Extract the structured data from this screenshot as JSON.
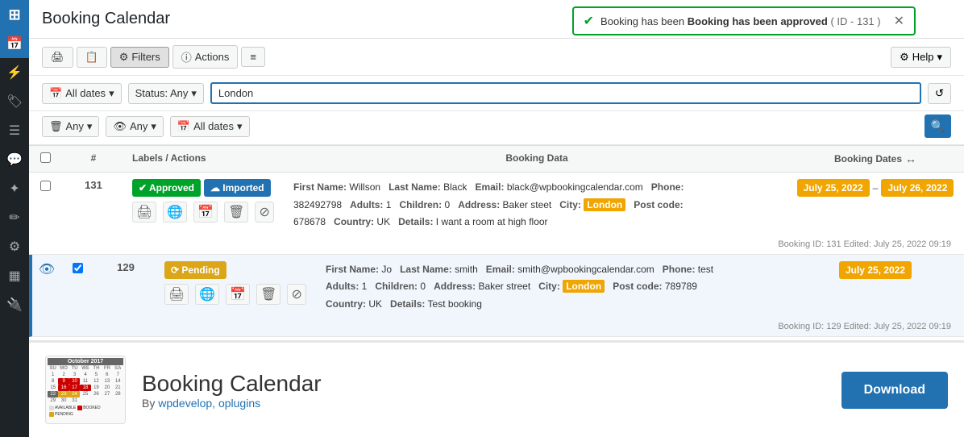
{
  "page": {
    "title": "Booking Calendar"
  },
  "notification": {
    "text": "Booking has been approved",
    "detail": "( ID - 131 )"
  },
  "toolbar": {
    "filters_label": "Filters",
    "actions_label": "Actions",
    "help_label": "Help"
  },
  "filters": {
    "dates_label": "All dates",
    "status_label": "Status: Any",
    "search_value": "London",
    "any1_label": "Any",
    "any2_label": "Any",
    "all_dates2_label": "All dates"
  },
  "table": {
    "col_labels": "Labels / Actions",
    "col_data": "Booking Data",
    "col_dates": "Booking Dates"
  },
  "bookings": [
    {
      "id": "131",
      "status": "Approved",
      "status_type": "approved",
      "imported": true,
      "first_name": "Willson",
      "last_name": "Black",
      "email": "black@wpbookingcalendar.com",
      "phone": "382492798",
      "adults": "1",
      "children": "0",
      "address": "Baker steet",
      "city": "London",
      "postcode": "678678",
      "country": "UK",
      "details": "I want a room at high floor",
      "date_start": "July 25, 2022",
      "date_end": "July 26, 2022",
      "meta": "Booking ID: 131  Edited: July 25, 2022 09:19",
      "checked": false,
      "highlighted": false
    },
    {
      "id": "129",
      "status": "Pending",
      "status_type": "pending",
      "imported": false,
      "first_name": "Jo",
      "last_name": "smith",
      "email": "smith@wpbookingcalendar.com",
      "phone": "test",
      "adults": "1",
      "children": "0",
      "address": "Baker street",
      "city": "London",
      "postcode": "789789",
      "country": "UK",
      "details": "Test booking",
      "date_start": "July 25, 2022",
      "date_end": null,
      "meta": "Booking ID: 129  Edited: July 25, 2022 09:19",
      "checked": true,
      "highlighted": true
    }
  ],
  "plugin": {
    "title": "Booking Calendar",
    "author": "By wpdevelop, oplugins",
    "author_link": "wpdevelop, oplugins",
    "download_label": "Download"
  },
  "sidebar": {
    "items": [
      "dashboard",
      "edit",
      "tag",
      "list",
      "comment",
      "wand",
      "pencil",
      "settings",
      "blocks",
      "plugin"
    ]
  }
}
